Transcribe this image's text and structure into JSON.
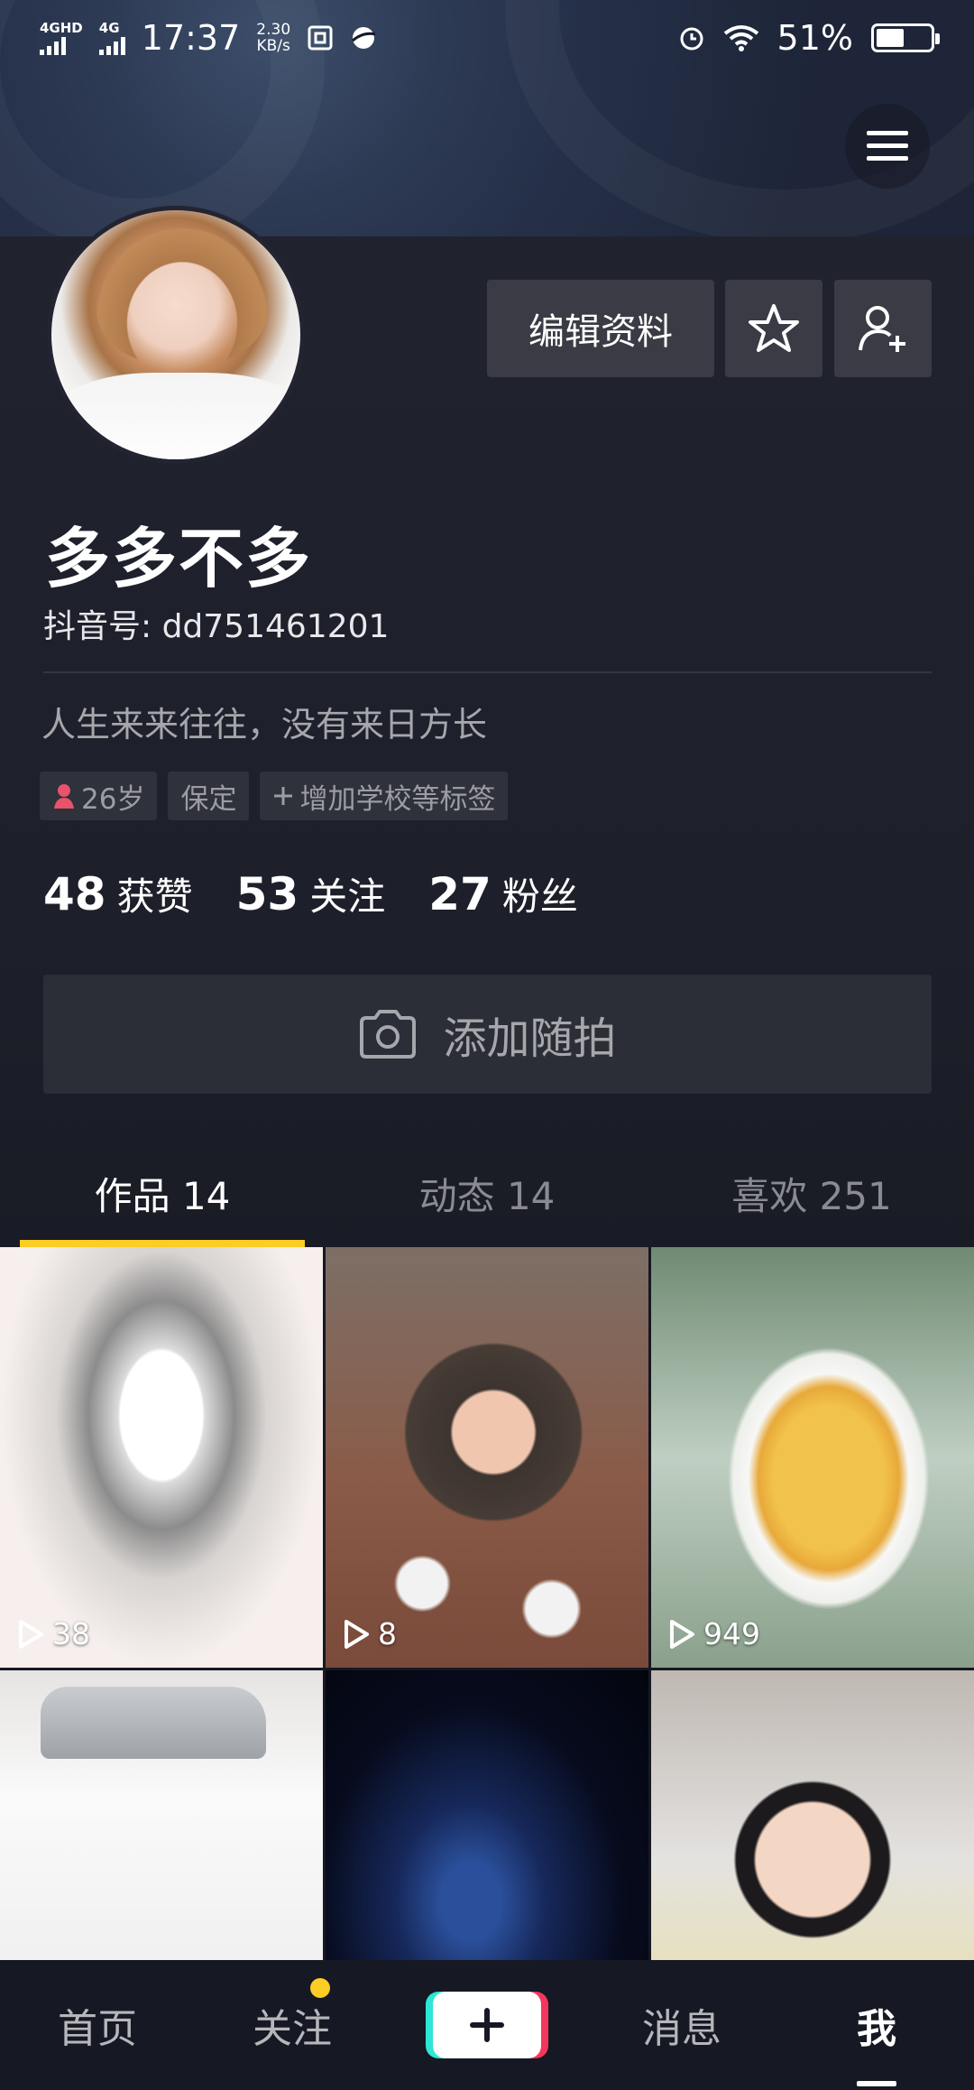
{
  "status_bar": {
    "network1": "4GHD",
    "network2": "4G",
    "time": "17:37",
    "speed_value": "2.30",
    "speed_unit": "KB/s",
    "battery": "51%"
  },
  "profile": {
    "edit_button": "编辑资料",
    "nickname": "多多不多",
    "douyin_id": "抖音号: dd751461201",
    "bio": "人生来来往往，没有来日方长",
    "tags": {
      "age": "26岁",
      "city": "保定",
      "add": "增加学校等标签"
    },
    "stats": {
      "likes_num": "48",
      "likes_label": "获赞",
      "following_num": "53",
      "following_label": "关注",
      "followers_num": "27",
      "followers_label": "粉丝"
    },
    "add_snap": "添加随拍"
  },
  "tabs": {
    "works": "作品 14",
    "moments": "动态 14",
    "likes": "喜欢 251"
  },
  "videos": [
    {
      "plays": "38"
    },
    {
      "plays": "8"
    },
    {
      "plays": "949"
    }
  ],
  "bottom_nav": {
    "home": "首页",
    "follow": "关注",
    "messages": "消息",
    "me": "我"
  },
  "colors": {
    "accent": "#fbcd25",
    "background": "#161823",
    "button": "#3a3b44"
  }
}
